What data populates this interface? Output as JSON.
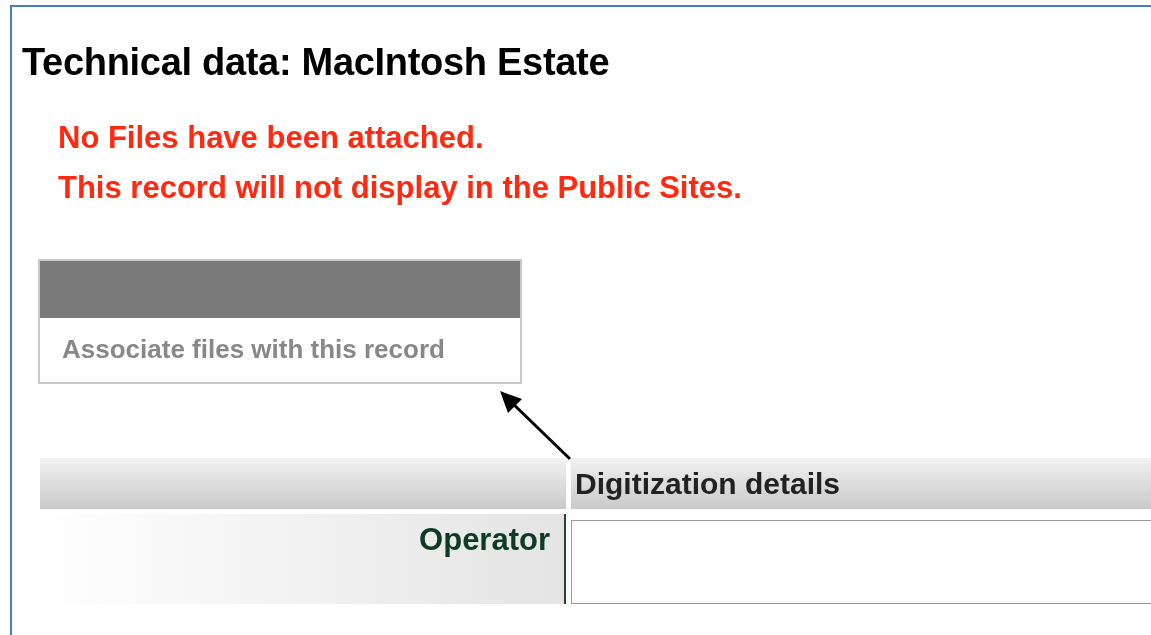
{
  "page": {
    "title": "Technical data: MacIntosh Estate"
  },
  "warnings": [
    "No Files have been attached.",
    "This record will not display in the Public Sites."
  ],
  "files_panel": {
    "link": "Associate files with this record"
  },
  "table": {
    "section_heading": "Digitization details",
    "rows": [
      {
        "label": "Operator",
        "value": ""
      }
    ]
  }
}
